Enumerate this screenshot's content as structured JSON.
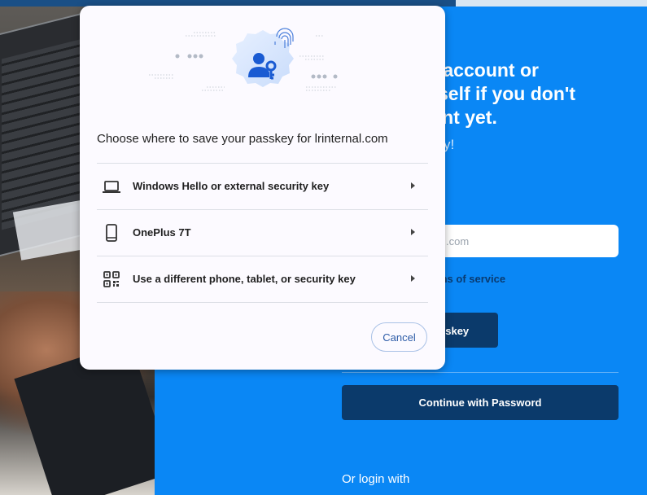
{
  "dialog": {
    "title": "Choose where to save your passkey for lrinternal.com",
    "options": [
      {
        "label": "Windows Hello or external security key",
        "icon": "laptop-icon"
      },
      {
        "label": "OnePlus 7T",
        "icon": "phone-icon"
      },
      {
        "label": "Use a different phone, tablet, or security key",
        "icon": "qr-code-icon"
      }
    ],
    "cancel_label": "Cancel"
  },
  "page": {
    "headline": "ur account or\nurself if you don't\nount yet.",
    "subtext": "y!",
    "email_fragment": ".com",
    "terms_fragment": "ms of service",
    "passkey_button_fragment": "sskey",
    "password_button_label": "Continue with Password",
    "or_login_with": "Or login with"
  },
  "colors": {
    "panel_blue": "#0a87f5",
    "button_navy": "#0b3a6b",
    "dialog_bg": "#fcfaff",
    "accent_blue": "#2c5ba7"
  }
}
